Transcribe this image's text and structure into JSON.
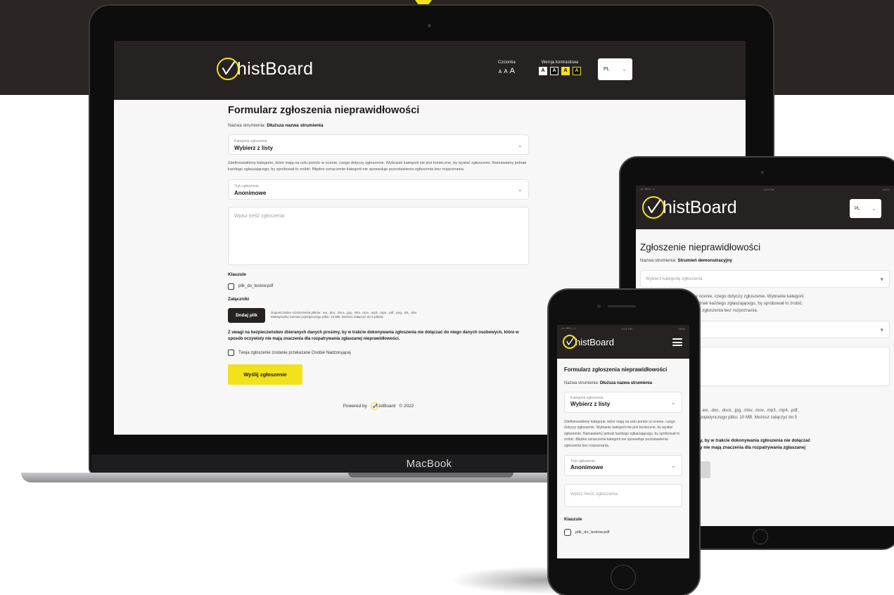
{
  "brand": {
    "name": "histBoard",
    "accent": "#f2e21b",
    "dark": "#262222"
  },
  "laptop": {
    "label": "MacBook",
    "header": {
      "font_label": "Czcionka",
      "font_sizes": [
        "A",
        "A",
        "A"
      ],
      "contrast_label": "Wersja kontrastowa",
      "contrast_options": [
        "A",
        "A",
        "A",
        "A"
      ],
      "language": "PL"
    },
    "form": {
      "title": "Formularz zgłoszenia nieprawidłowości",
      "stream_label": "Nazwa strumienia:",
      "stream_value": "Dłuższa nazwa strumienia",
      "category_label": "Kategoria zgłoszenia",
      "category_value": "Wybierz z listy",
      "category_help": "Zdefiniowaliśmy kategorie, które mają na celu pomóc w ocenie, czego dotyczy zgłoszenie. Wybranie kategorii nie jest konieczne, by wysłać zgłoszenie. Namawiamy jednak każdego zgłaszającego, by spróbował to zrobić. Błędne oznaczenie kategorii nie spowoduje pozostawienia zgłoszenia bez rozpoznania.",
      "mode_label": "Tryb zgłoszenia",
      "mode_value": "Anonimowe",
      "content_placeholder": "Wpisz treść zgłoszenia",
      "clauses_label": "Klauzule",
      "clause_file": "plik_do_testow.pdf",
      "attachments_label": "Załączniki",
      "add_file_button": "Dodaj plik",
      "allowed_extensions": "Dopuszczalne rozszerzenia plików: .avi, .doc, .docx, .jpg, .mkv, .mov, .mp3, .mp4, .pdf, .png, .xls, .xlsx",
      "max_size_text": "Maksymalny rozmiar pojedynczego pliku: 10 MB. Możesz załączyć do 5 plików",
      "privacy_notice": "Z uwagi na bezpieczeństwo zbieranych danych prosimy, by w trakcie dokonywania zgłoszenia nie dołączać do niego danych osobowych, które w sposób oczywisty nie mają znaczenia dla rozpatrywania zgłaszanej nieprawidłowości.",
      "supervisor_checkbox": "Twoja zgłoszenie zostanie przekazane Osobie Nadzorującej",
      "submit_button": "Wyślij zgłoszenie"
    },
    "footer": {
      "powered_by": "Powered by",
      "brand": "histBoard",
      "year": "© 2022"
    }
  },
  "tablet": {
    "status": {
      "carrier": "•••• BELL ᯤ",
      "time": "4:21 PM",
      "battery": "100%"
    },
    "language": "PL",
    "form": {
      "title": "Zgłoszenie nieprawidłowości",
      "stream_label": "Nazwa strumienia:",
      "stream_value": "Strumień demonstracyjny",
      "category_placeholder": "Wybierz kategorię zgłoszenia",
      "help_lines": [
        ", które mają na celu pomóc w ocenie, czego dotyczy zgłoszenie. Wybranie kategorii",
        "ać zgłoszenie. Namawiamy jednak każdego zgłaszającego, by spróbował to zrobić.",
        "ii nie spowoduje pozostawienia zgłoszenia bez rozpoznania."
      ],
      "upload_lines": [
        "uszczalne rozszerzenia plików: .avi, .doc, .docx, .jpg, .mkv, .mov, .mp3, .mp4, .pdf,",
        ".xls, .xlsx Maksymalny rozmiar pojedynczego pliku: 10 MB. Możesz załączyć do 5",
        "w."
      ],
      "notice_lines": [
        "o zbieranych danych prosimy, by w trakcie dokonywania zgłoszenia nie dołączać",
        "ch, które w sposób oczywisty nie mają znaczenia dla rozpatrywania zgłaszanej"
      ]
    }
  },
  "phone": {
    "status": {
      "carrier": "•••• BELL ᯤ",
      "time": "4:21 PM",
      "battery": "100%"
    },
    "form": {
      "title": "Formularz zgłoszenia nieprawidłowości",
      "stream_label": "Nazwa strumienia:",
      "stream_value": "Dłuższa nazwa strumienia",
      "category_label": "Kategoria zgłoszenia",
      "category_value": "Wybierz z listy",
      "category_help": "Zdefiniowaliśmy kategorie, które mają na celu pomóc w ocenie, czego dotyczy zgłoszenie. Wybranie kategorii nie jest konieczne, by wysłać zgłoszenie. Namawiamy jednak każdego zgłaszającego, by spróbował to zrobić. Błędne oznaczenie kategorii nie spowoduje pozostawienia zgłoszenia bez rozpoznania.",
      "mode_label": "Tryb zgłoszenia",
      "mode_value": "Anonimowe",
      "content_placeholder": "Wpisz treść zgłoszenia",
      "clauses_label": "Klauzule",
      "clause_file": "plik_do_testow.pdf"
    }
  }
}
